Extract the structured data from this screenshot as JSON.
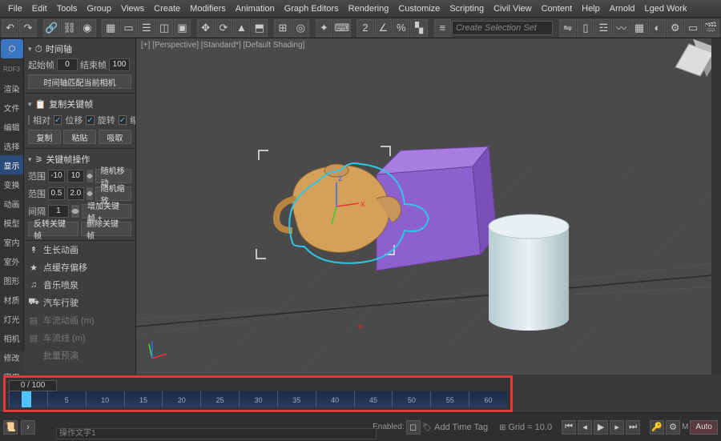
{
  "menu": [
    "File",
    "Edit",
    "Tools",
    "Group",
    "Views",
    "Create",
    "Modifiers",
    "Animation",
    "Graph Editors",
    "Rendering",
    "Customize",
    "Scripting",
    "Civil View",
    "Content",
    "Help",
    "Arnold",
    "Lged Work"
  ],
  "selset_placeholder": "Create Selection Set",
  "viewport_label": "[+] [Perspective] [Standard*] [Default Shading]",
  "leftstrip_logo": "RDF3",
  "leftstrip_items": [
    "渲染",
    "文件",
    "编辑",
    "选择",
    "显示",
    "变换",
    "动画",
    "模型",
    "室内",
    "室外",
    "图形",
    "材质",
    "灯光",
    "相机",
    "修改",
    "实用"
  ],
  "leftstrip_hl_idx": 4,
  "panel": {
    "time": {
      "title": "时间轴",
      "start_lbl": "起始帧",
      "start": "0",
      "end_lbl": "结束帧",
      "end": "100",
      "match_btn": "时间轴匹配当前相机"
    },
    "copy": {
      "title": "复制关键帧",
      "opts": [
        "相对",
        "位移",
        "旋转",
        "缩放"
      ],
      "checked": [
        false,
        true,
        true,
        true
      ],
      "btns": [
        "复制",
        "粘贴",
        "吸取"
      ]
    },
    "kf": {
      "title": "关键帧操作",
      "range_a_lbl": "范围",
      "range_a1": "-10",
      "range_a2": "10",
      "rand_move": "随机移动",
      "range_b_lbl": "范围",
      "range_b1": "0.5",
      "range_b2": "2.0",
      "rand_scale": "随机缩放",
      "interval_lbl": "间隔",
      "interval": "1",
      "add_btn": "增加关键帧 +",
      "reverse": "反转关键帧",
      "delete": "删除关键帧"
    },
    "anims": [
      {
        "ic": "↟",
        "t": "生长动画"
      },
      {
        "ic": "★",
        "t": "点缓存偏移"
      },
      {
        "ic": "♫",
        "t": "音乐喷泉"
      },
      {
        "ic": "⛟",
        "t": "汽车行驶"
      },
      {
        "ic": "▤",
        "t": "车流动画 (m)"
      },
      {
        "ic": "▤",
        "t": "车流线 (m)"
      },
      {
        "ic": " ",
        "t": "批量预演"
      }
    ]
  },
  "timeline": {
    "frame": "0 / 100",
    "ticks": [
      "0",
      "5",
      "10",
      "15",
      "20",
      "25",
      "30",
      "35",
      "40",
      "45",
      "50",
      "55",
      "60"
    ]
  },
  "status": {
    "cmd_placeholder": "操作文字1",
    "enabled_lbl": "Enabled:",
    "grid_lbl": "Grid = 10.0",
    "timetag": "Add Time Tag",
    "script_lbl": "M",
    "auto": "Auto"
  }
}
